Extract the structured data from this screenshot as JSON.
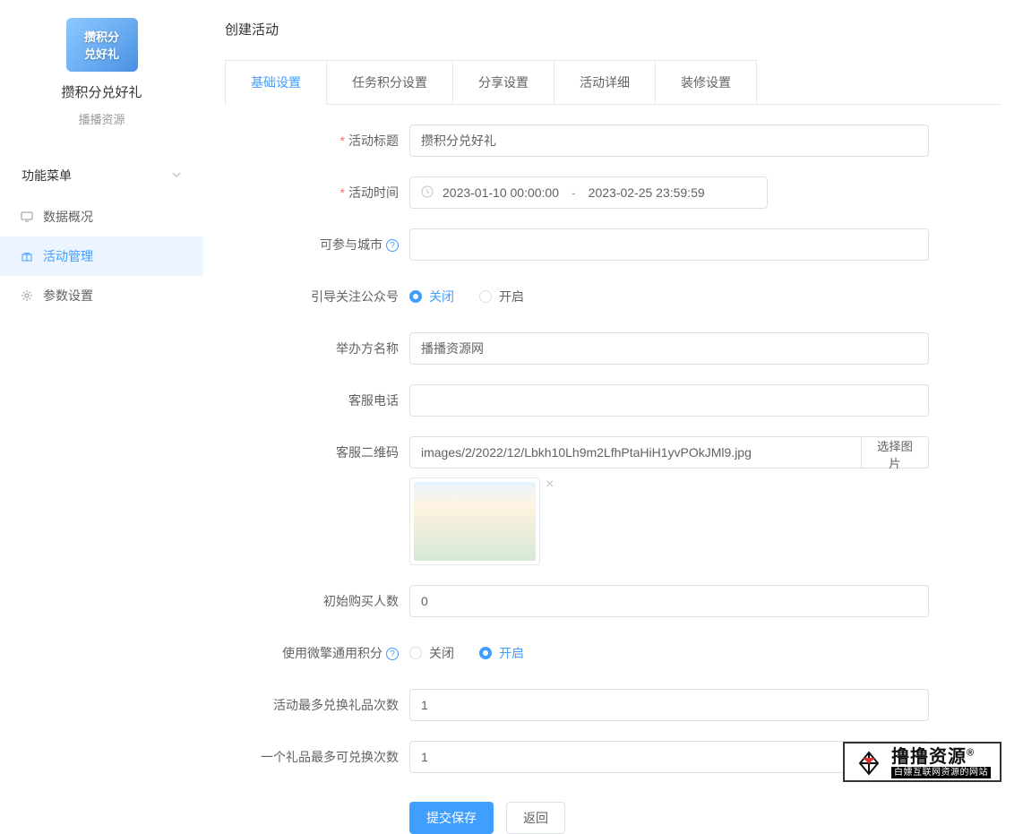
{
  "sidebar": {
    "logo_line1": "攒积分",
    "logo_line2": "兑好礼",
    "title": "攒积分兑好礼",
    "sub": "播播资源",
    "menu_head": "功能菜单",
    "items": [
      {
        "label": "数据概况"
      },
      {
        "label": "活动管理"
      },
      {
        "label": "参数设置"
      }
    ]
  },
  "page": {
    "title": "创建活动"
  },
  "tabs": [
    {
      "label": "基础设置"
    },
    {
      "label": "任务积分设置"
    },
    {
      "label": "分享设置"
    },
    {
      "label": "活动详细"
    },
    {
      "label": "装修设置"
    }
  ],
  "form": {
    "activity_title_label": "活动标题",
    "activity_title_value": "攒积分兑好礼",
    "activity_time_label": "活动时间",
    "activity_time_start": "2023-01-10 00:00:00",
    "activity_time_end": "2023-02-25 23:59:59",
    "activity_time_sep": "-",
    "city_label": "可参与城市",
    "follow_label": "引导关注公众号",
    "radio_close": "关闭",
    "radio_open": "开启",
    "organizer_label": "举办方名称",
    "organizer_value": "播播资源网",
    "service_tel_label": "客服电话",
    "service_tel_value": "",
    "qr_label": "客服二维码",
    "qr_path": "images/2/2022/12/Lbkh10Lh9m2LfhPtaHiH1yvPOkJMl9.jpg",
    "select_image": "选择图片",
    "initial_buyers_label": "初始购买人数",
    "initial_buyers_value": "0",
    "use_points_label": "使用微擎通用积分",
    "max_redeem_label": "活动最多兑换礼品次数",
    "max_redeem_value": "1",
    "per_gift_label": "一个礼品最多可兑换次数",
    "per_gift_value": "1",
    "submit": "提交保存",
    "back": "返回"
  },
  "watermark": {
    "main": "撸撸资源",
    "reg": "®",
    "sub": "白嫖互联网资源的网站"
  }
}
